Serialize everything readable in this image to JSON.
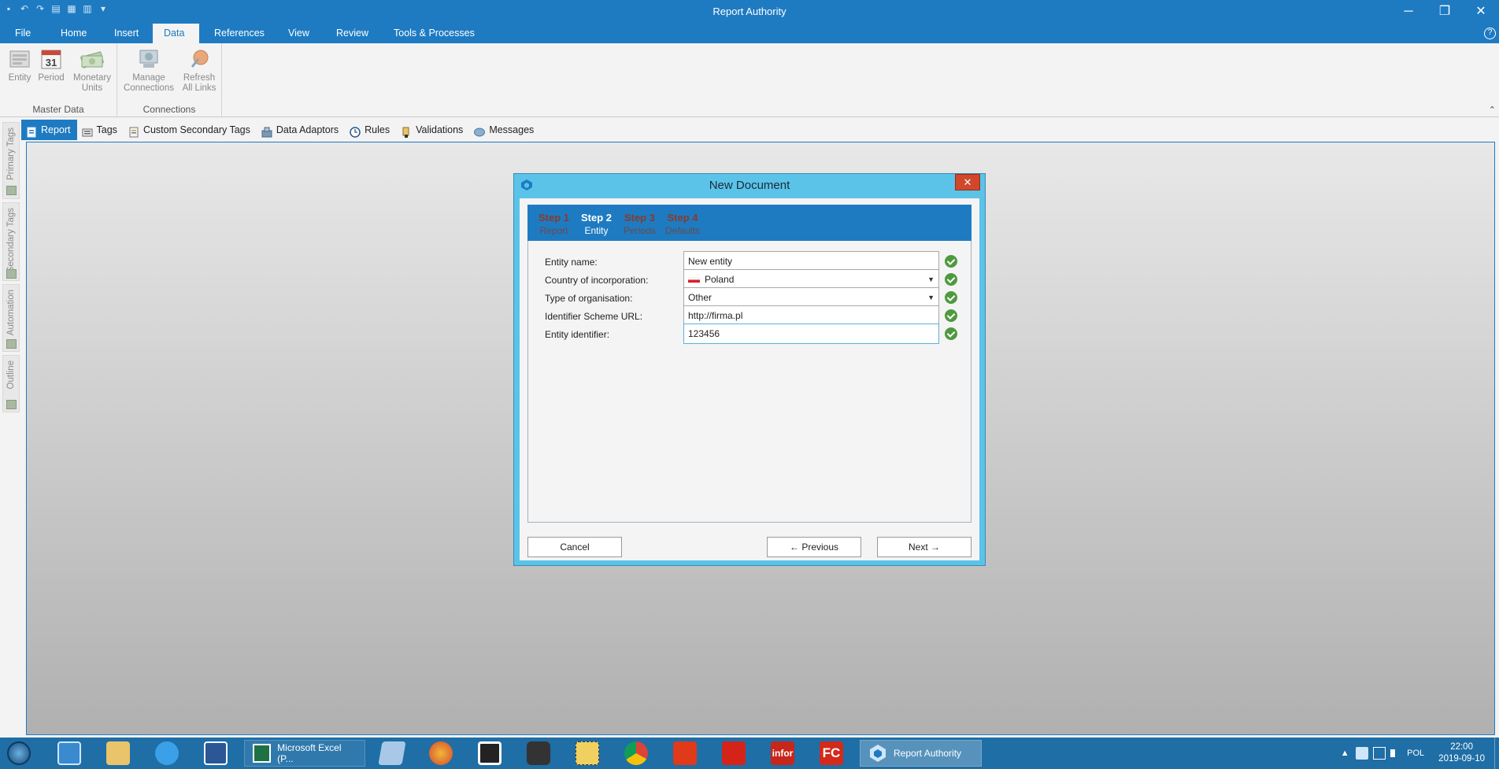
{
  "window": {
    "title": "Report Authority",
    "controls": {
      "minimize": "─",
      "maximize": "❐",
      "close": "✕"
    }
  },
  "qat": {
    "icons": [
      "save-icon",
      "undo-icon",
      "redo-icon",
      "print-icon",
      "add-icon",
      "book-icon",
      "customize-icon"
    ]
  },
  "ribbon": {
    "tabs": [
      "File",
      "Home",
      "Insert",
      "Data",
      "References",
      "View",
      "Review",
      "Tools & Processes"
    ],
    "active_tab": "Data",
    "groups": [
      {
        "label": "Master Data",
        "buttons": [
          {
            "label": "Entity",
            "icon": "entity-icon"
          },
          {
            "label": "Period",
            "icon": "calendar-icon",
            "badge": "31"
          },
          {
            "label_line1": "Monetary",
            "label_line2": "Units",
            "icon": "money-icon"
          }
        ]
      },
      {
        "label": "Connections",
        "buttons": [
          {
            "label_line1": "Manage",
            "label_line2": "Connections",
            "icon": "connections-icon"
          },
          {
            "label_line1": "Refresh",
            "label_line2": "All Links",
            "icon": "refresh-links-icon"
          }
        ]
      }
    ],
    "help": "?"
  },
  "side_tabs": [
    "Primary Tags",
    "Secondary Tags",
    "Automation",
    "Outline"
  ],
  "sub_tabs": [
    {
      "label": "Report",
      "icon": "report-icon",
      "active": true
    },
    {
      "label": "Tags",
      "icon": "tags-icon"
    },
    {
      "label": "Custom Secondary Tags",
      "icon": "custom-tags-icon"
    },
    {
      "label": "Data Adaptors",
      "icon": "data-adaptors-icon"
    },
    {
      "label": "Rules",
      "icon": "clock-icon"
    },
    {
      "label": "Validations",
      "icon": "validations-icon"
    },
    {
      "label": "Messages",
      "icon": "messages-icon"
    }
  ],
  "dialog": {
    "title": "New Document",
    "close": "✕",
    "steps": [
      {
        "num": "Step 1",
        "name": "Report",
        "state": "done"
      },
      {
        "num": "Step 2",
        "name": "Entity",
        "state": "current"
      },
      {
        "num": "Step 3",
        "name": "Periods",
        "state": "todo"
      },
      {
        "num": "Step 4",
        "name": "Defaults",
        "state": "todo"
      }
    ],
    "fields": [
      {
        "label": "Entity name:",
        "value": "New entity",
        "type": "text"
      },
      {
        "label": "Country of incorporation:",
        "value": "Poland",
        "type": "select",
        "flag": "poland-flag-icon"
      },
      {
        "label": "Type of organisation:",
        "value": "Other",
        "type": "select"
      },
      {
        "label": "Identifier Scheme URL:",
        "value": "http://firma.pl",
        "type": "text"
      },
      {
        "label": "Entity identifier:",
        "value": "123456",
        "type": "text",
        "focused": true
      }
    ],
    "buttons": {
      "cancel": "Cancel",
      "previous": "← Previous",
      "next": "Next →"
    }
  },
  "taskbar": {
    "pinned": [
      "start-icon",
      "network-icon",
      "folder-icon",
      "ie-icon",
      "word-icon"
    ],
    "tasks": [
      {
        "label": "Microsoft Excel (P...",
        "icon": "excel-icon"
      },
      {
        "label": "Report Authority",
        "icon": "report-authority-icon",
        "active": true
      }
    ],
    "more_pinned": [
      "notebook-icon",
      "firefox-icon",
      "app-icon",
      "database-icon",
      "tool-icon",
      "chrome-icon",
      "office-icon",
      "acrobat-icon",
      "infor-icon",
      "fc-icon"
    ],
    "infor_label": "infor",
    "fc_label": "FC",
    "tray": {
      "language": "POL",
      "time": "22:00",
      "date": "2019-09-10",
      "chevron": "▲"
    }
  },
  "colors": {
    "accent": "#1e7bc2",
    "dialog_frame": "#5bc3e8",
    "ok_green": "#4e9a3e",
    "close_red": "#d0472a"
  }
}
